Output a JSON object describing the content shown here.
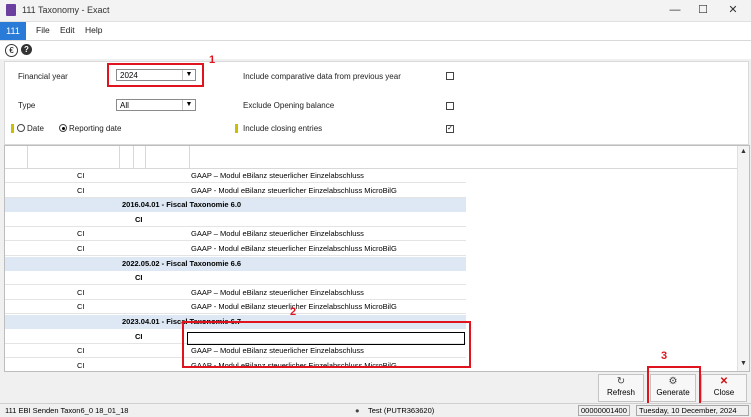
{
  "window": {
    "title": "111 Taxonomy - Exact"
  },
  "menubar": {
    "badge": "111",
    "items": [
      "File",
      "Edit",
      "Help"
    ]
  },
  "icons": {
    "euro": "€",
    "help": "?"
  },
  "form": {
    "financial_year_label": "Financial year",
    "financial_year_value": "2024",
    "comparative_label": "Include comparative data from previous year",
    "comparative_checked": false,
    "type_label": "Type",
    "type_value": "All",
    "exclude_opening_label": "Exclude Opening balance",
    "exclude_opening_checked": false,
    "date_label": "Date",
    "reporting_date_label": "Reporting date",
    "selected_radio": "Reporting date",
    "closing_entries_label": "Include closing entries",
    "closing_entries_checked": true
  },
  "grid": {
    "rows": [
      {
        "kind": "item",
        "ci": "CI",
        "desc": "GAAP – Modul eBilanz steuerlicher Einzelabschluss"
      },
      {
        "kind": "item",
        "ci": "CI",
        "desc": "GAAP - Modul eBilanz steuerlicher Einzelabschluss MicroBilG"
      },
      {
        "kind": "group",
        "title": "2016.04.01 - Fiscal Taxonomie 6.0"
      },
      {
        "kind": "subci",
        "ci": "CI"
      },
      {
        "kind": "item",
        "ci": "CI",
        "desc": "GAAP – Modul eBilanz steuerlicher Einzelabschluss"
      },
      {
        "kind": "item",
        "ci": "CI",
        "desc": "GAAP - Modul eBilanz steuerlicher Einzelabschluss MicroBilG"
      },
      {
        "kind": "group",
        "title": "2022.05.02 - Fiscal Taxonomie 6.6"
      },
      {
        "kind": "subci",
        "ci": "CI"
      },
      {
        "kind": "item",
        "ci": "CI",
        "desc": "GAAP – Modul eBilanz steuerlicher Einzelabschluss"
      },
      {
        "kind": "item",
        "ci": "CI",
        "desc": "GAAP - Modul eBilanz steuerlicher Einzelabschluss MicroBilG"
      },
      {
        "kind": "group",
        "title": "2023.04.01 - Fiscal Taxonomie 6.7"
      },
      {
        "kind": "subci",
        "ci": "CI"
      },
      {
        "kind": "item",
        "ci": "CI",
        "desc": "GAAP – Modul eBilanz steuerlicher Einzelabschluss"
      },
      {
        "kind": "item",
        "ci": "CI",
        "desc": "GAAP - Modul eBilanz steuerlicher Einzelabschluss MicroBilG"
      }
    ]
  },
  "annotations": [
    "1",
    "2",
    "3"
  ],
  "buttons": {
    "refresh": "Refresh",
    "generate": "Generate",
    "close": "Close"
  },
  "status": {
    "left": "111 EBI Senden Taxon6_0 18_01_18",
    "user": "Test (PUTR363620)",
    "number": "00000001400",
    "date": "Tuesday, 10 December, 2024"
  },
  "colors": {
    "annotation_red": "#e0141e",
    "accent_blue": "#2a7bd8",
    "group_row": "#dde8f4"
  }
}
